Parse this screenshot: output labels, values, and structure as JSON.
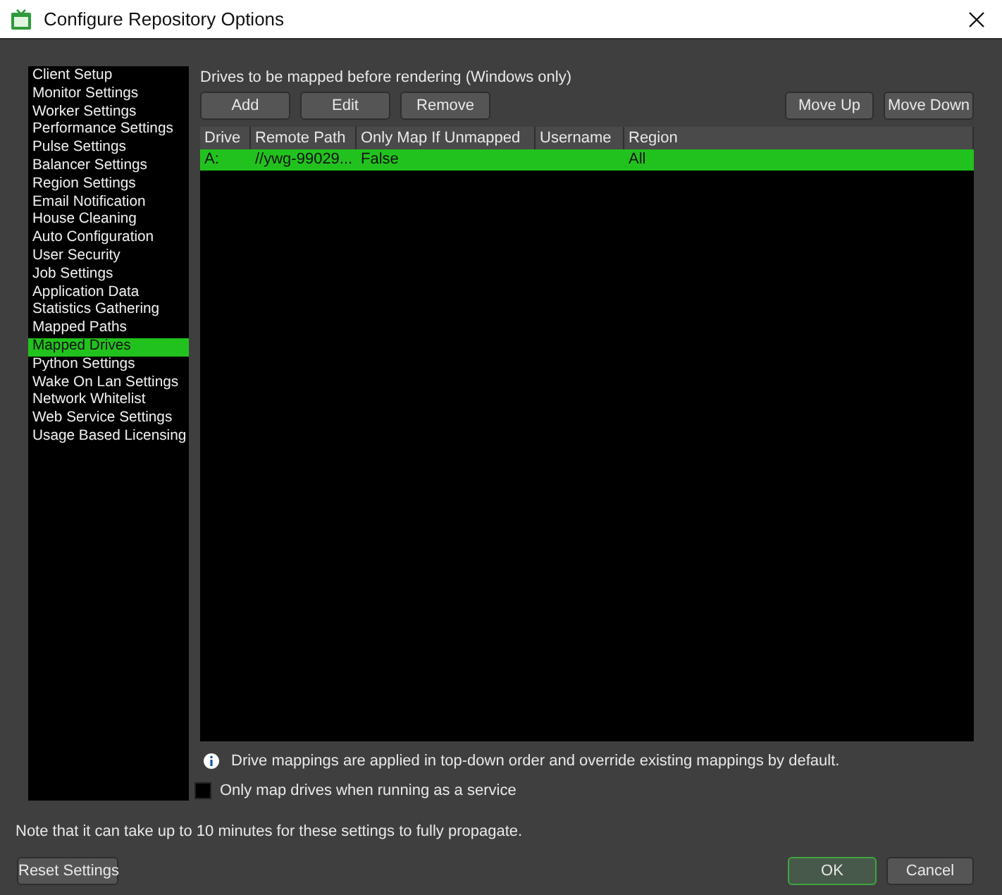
{
  "window": {
    "title": "Configure Repository Options"
  },
  "sidebar": {
    "items": [
      {
        "label": "Client Setup",
        "selected": false
      },
      {
        "label": "Monitor Settings",
        "selected": false
      },
      {
        "label": "Worker Settings",
        "selected": false
      },
      {
        "label": "Performance Settings",
        "selected": false
      },
      {
        "label": "Pulse Settings",
        "selected": false
      },
      {
        "label": "Balancer Settings",
        "selected": false
      },
      {
        "label": "Region Settings",
        "selected": false
      },
      {
        "label": "Email Notification",
        "selected": false
      },
      {
        "label": "House Cleaning",
        "selected": false
      },
      {
        "label": "Auto Configuration",
        "selected": false
      },
      {
        "label": "User Security",
        "selected": false
      },
      {
        "label": "Job Settings",
        "selected": false
      },
      {
        "label": "Application Data",
        "selected": false
      },
      {
        "label": "Statistics Gathering",
        "selected": false
      },
      {
        "label": "Mapped Paths",
        "selected": false
      },
      {
        "label": "Mapped Drives",
        "selected": true
      },
      {
        "label": "Python Settings",
        "selected": false
      },
      {
        "label": "Wake On Lan Settings",
        "selected": false
      },
      {
        "label": "Network Whitelist",
        "selected": false
      },
      {
        "label": "Web Service Settings",
        "selected": false
      },
      {
        "label": "Usage Based Licensing",
        "selected": false
      }
    ]
  },
  "panel": {
    "heading": "Drives to be mapped before rendering (Windows only)",
    "left_buttons": [
      "Add",
      "Edit",
      "Remove"
    ],
    "right_buttons": [
      "Move Up",
      "Move Down"
    ],
    "table": {
      "columns": [
        "Drive",
        "Remote Path",
        "Only Map If Unmapped",
        "Username",
        "Region"
      ],
      "rows": [
        {
          "cells": [
            "A:",
            "//ywg-99029...",
            "False",
            "",
            "All"
          ],
          "selected": true
        }
      ]
    },
    "info": "Drive mappings are applied in top-down order and override existing mappings by default.",
    "service_checkbox": {
      "label": "Only map drives when running as a service",
      "checked": false
    }
  },
  "note": "Note that it can take up to 10 minutes for these settings to fully propagate.",
  "footer": {
    "reset": "Reset Settings",
    "ok": "OK",
    "cancel": "Cancel"
  }
}
